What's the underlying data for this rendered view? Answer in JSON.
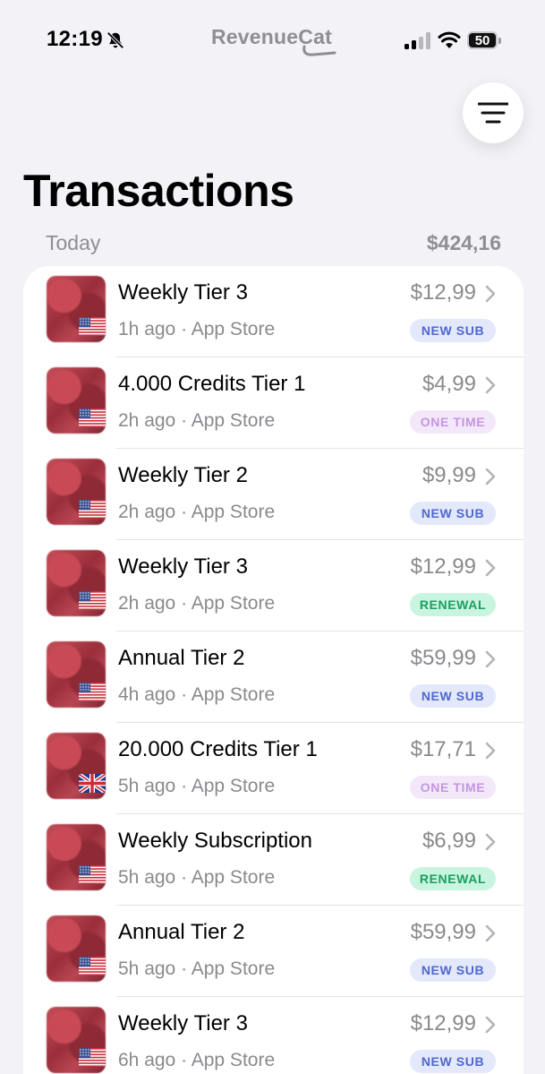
{
  "status_bar": {
    "time": "12:19",
    "brand": "RevenueCat",
    "battery": "50"
  },
  "page": {
    "title": "Transactions"
  },
  "section": {
    "label": "Today",
    "total": "$424,16"
  },
  "colors": {
    "new_sub_bg": "#e3e8fb",
    "new_sub_text": "#4f68cf",
    "one_time_bg": "#f3e8fa",
    "one_time_text": "#c595e0",
    "renewal_bg": "#c9f5e0",
    "renewal_text": "#1a9e60"
  },
  "transactions": [
    {
      "title": "Weekly Tier 3",
      "subtitle": "1h ago · App Store",
      "price": "$12,99",
      "badge": "NEW SUB",
      "badge_type": "new-sub",
      "flag": "us-flag-icon"
    },
    {
      "title": "4.000 Credits Tier 1",
      "subtitle": "2h ago · App Store",
      "price": "$4,99",
      "badge": "ONE TIME",
      "badge_type": "one-time",
      "flag": "us-flag-icon"
    },
    {
      "title": "Weekly Tier 2",
      "subtitle": "2h ago · App Store",
      "price": "$9,99",
      "badge": "NEW SUB",
      "badge_type": "new-sub",
      "flag": "us-flag-icon"
    },
    {
      "title": "Weekly Tier 3",
      "subtitle": "2h ago · App Store",
      "price": "$12,99",
      "badge": "RENEWAL",
      "badge_type": "renewal",
      "flag": "us-flag-icon"
    },
    {
      "title": "Annual Tier 2",
      "subtitle": "4h ago · App Store",
      "price": "$59,99",
      "badge": "NEW SUB",
      "badge_type": "new-sub",
      "flag": "us-flag-icon"
    },
    {
      "title": "20.000 Credits Tier 1",
      "subtitle": "5h ago · App Store",
      "price": "$17,71",
      "badge": "ONE TIME",
      "badge_type": "one-time",
      "flag": "uk-flag-icon"
    },
    {
      "title": "Weekly Subscription",
      "subtitle": "5h ago · App Store",
      "price": "$6,99",
      "badge": "RENEWAL",
      "badge_type": "renewal",
      "flag": "us-flag-icon"
    },
    {
      "title": "Annual Tier 2",
      "subtitle": "5h ago · App Store",
      "price": "$59,99",
      "badge": "NEW SUB",
      "badge_type": "new-sub",
      "flag": "us-flag-icon"
    },
    {
      "title": "Weekly Tier 3",
      "subtitle": "6h ago · App Store",
      "price": "$12,99",
      "badge": "NEW SUB",
      "badge_type": "new-sub",
      "flag": "us-flag-icon"
    }
  ]
}
